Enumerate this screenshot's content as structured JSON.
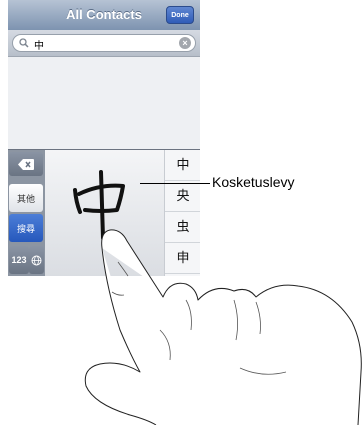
{
  "navbar": {
    "title": "All Contacts",
    "done_label": "Done"
  },
  "search": {
    "value": "中"
  },
  "keyboard": {
    "other_label": "其他",
    "search_label": "搜尋",
    "numbers_label": "123",
    "candidates": [
      "中",
      "央",
      "虫",
      "申"
    ]
  },
  "callout": {
    "label": "Kosketuslevy"
  },
  "colors": {
    "navbar": "#7d93b0",
    "search_key": "#2658bc",
    "keyboard": "#8c95a2"
  }
}
